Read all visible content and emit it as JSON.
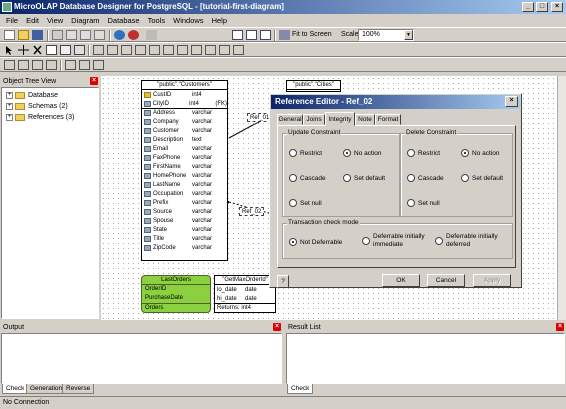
{
  "window": {
    "title": "MicroOLAP Database Designer for PostgreSQL - [tutorial-first-diagram]"
  },
  "menu": [
    "File",
    "Edit",
    "View",
    "Diagram",
    "Database",
    "Tools",
    "Windows",
    "Help"
  ],
  "toolbar": {
    "fit_label": "Fit to Screen",
    "scale_label": "Scale:",
    "scale_value": "100%"
  },
  "object_tree": {
    "title": "Object Tree View",
    "items": [
      {
        "label": "Database"
      },
      {
        "label": "Schemas (2)"
      },
      {
        "label": "References (3)"
      }
    ]
  },
  "diagram": {
    "customers": {
      "title": "\"public\".\"Customers\"",
      "fields": [
        {
          "name": "CustID",
          "type": "int4",
          "extra": "",
          "key": true
        },
        {
          "name": "CityID",
          "type": "int4",
          "extra": "(FK)",
          "key": false
        },
        {
          "name": "Address",
          "type": "varchar",
          "extra": "",
          "key": false
        },
        {
          "name": "Company",
          "type": "varchar",
          "extra": "",
          "key": false
        },
        {
          "name": "Customer",
          "type": "varchar",
          "extra": "",
          "key": false
        },
        {
          "name": "Description",
          "type": "text",
          "extra": "",
          "key": false
        },
        {
          "name": "Email",
          "type": "varchar",
          "extra": "",
          "key": false
        },
        {
          "name": "FaxPhone",
          "type": "varchar",
          "extra": "",
          "key": false
        },
        {
          "name": "FirstName",
          "type": "varchar",
          "extra": "",
          "key": false
        },
        {
          "name": "HomePhone",
          "type": "varchar",
          "extra": "",
          "key": false
        },
        {
          "name": "LastName",
          "type": "varchar",
          "extra": "",
          "key": false
        },
        {
          "name": "Occupation",
          "type": "varchar",
          "extra": "",
          "key": false
        },
        {
          "name": "Prefix",
          "type": "varchar",
          "extra": "",
          "key": false
        },
        {
          "name": "Source",
          "type": "varchar",
          "extra": "",
          "key": false
        },
        {
          "name": "Spouse",
          "type": "varchar",
          "extra": "",
          "key": false
        },
        {
          "name": "State",
          "type": "varchar",
          "extra": "",
          "key": false
        },
        {
          "name": "Title",
          "type": "varchar",
          "extra": "",
          "key": false
        },
        {
          "name": "ZipCode",
          "type": "varchar",
          "extra": "",
          "key": false
        }
      ]
    },
    "cities_title": "\"public\".\"Cities\"",
    "ref_01": "Ref_01",
    "ref_02": "Ref_02",
    "last_orders": {
      "title": "LastOrders",
      "rows": [
        "OrderID",
        "PurchaseDate",
        "Orders"
      ]
    },
    "get_max_order": {
      "title": "\"GetMaxOrderId\"",
      "rows": [
        {
          "name": "lo_date",
          "type": "date"
        },
        {
          "name": "hi_date",
          "type": "date"
        }
      ],
      "returns": "Returns: int4"
    }
  },
  "dialog": {
    "title": "Reference Editor - Ref_02",
    "tabs": [
      "General",
      "Joins",
      "Integrity",
      "Note",
      "Format"
    ],
    "update_group": "Update Constraint",
    "delete_group": "Delete Constraint",
    "update_options": [
      "Restrict",
      "No action",
      "Cascade",
      "Set default",
      "Set null"
    ],
    "delete_options": [
      "Restrict",
      "No action",
      "Cascade",
      "Set default",
      "Set null"
    ],
    "tx_group": "Transaction check mode",
    "tx_options": [
      "Not Deferrable",
      "Deferrable initially immediate",
      "Deferrable initially deferred"
    ],
    "help_label": "?",
    "ok_label": "OK",
    "cancel_label": "Cancel",
    "apply_label": "Apply"
  },
  "output": {
    "title": "Output",
    "tabs": [
      "Check",
      "Generation",
      "Reverse"
    ]
  },
  "result": {
    "title": "Result List",
    "tabs": [
      "Check"
    ]
  },
  "status": {
    "text": "No Connection"
  }
}
